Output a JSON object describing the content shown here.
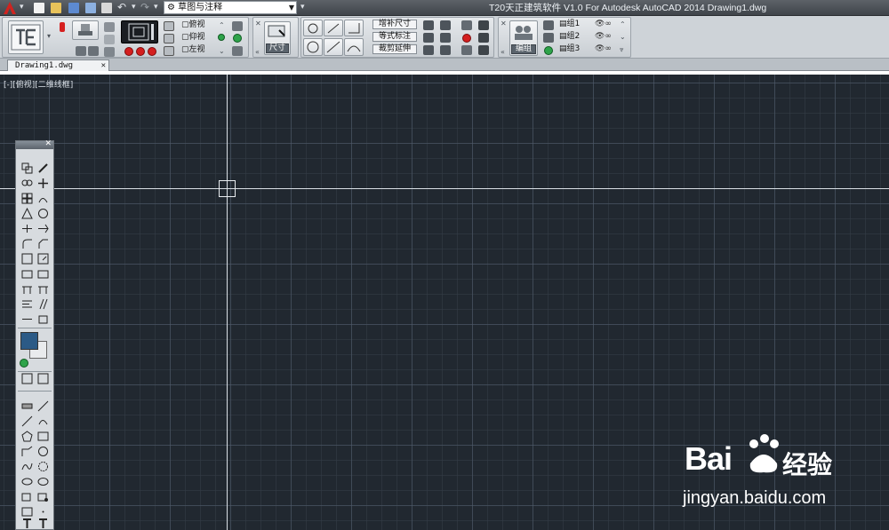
{
  "titlebar": {
    "workspace_select": "草图与注释",
    "title": "T20天正建筑软件 V1.0 For Autodesk AutoCAD 2014    Drawing1.dwg"
  },
  "toolbar": {
    "views": [
      "俯视",
      "仰视",
      "左视"
    ],
    "dimension_button": "尺寸",
    "annotation_buttons": [
      "增补尺寸",
      "等式标注",
      "裁剪延伸"
    ],
    "group_button": "编组",
    "groups": [
      "组1",
      "组2",
      "组3"
    ]
  },
  "document": {
    "tab_label": "Drawing1.dwg"
  },
  "viewport": {
    "label": "[-][俯视][二维线框]"
  },
  "watermark": {
    "brand": "Bai",
    "suffix": "经验",
    "url": "jingyan.baidu.com"
  },
  "colors": {
    "canvas_bg": "#212830",
    "toolbar_bg": "#ced3d8",
    "accent_red": "#d41f1f",
    "accent_green": "#2ea34a"
  }
}
